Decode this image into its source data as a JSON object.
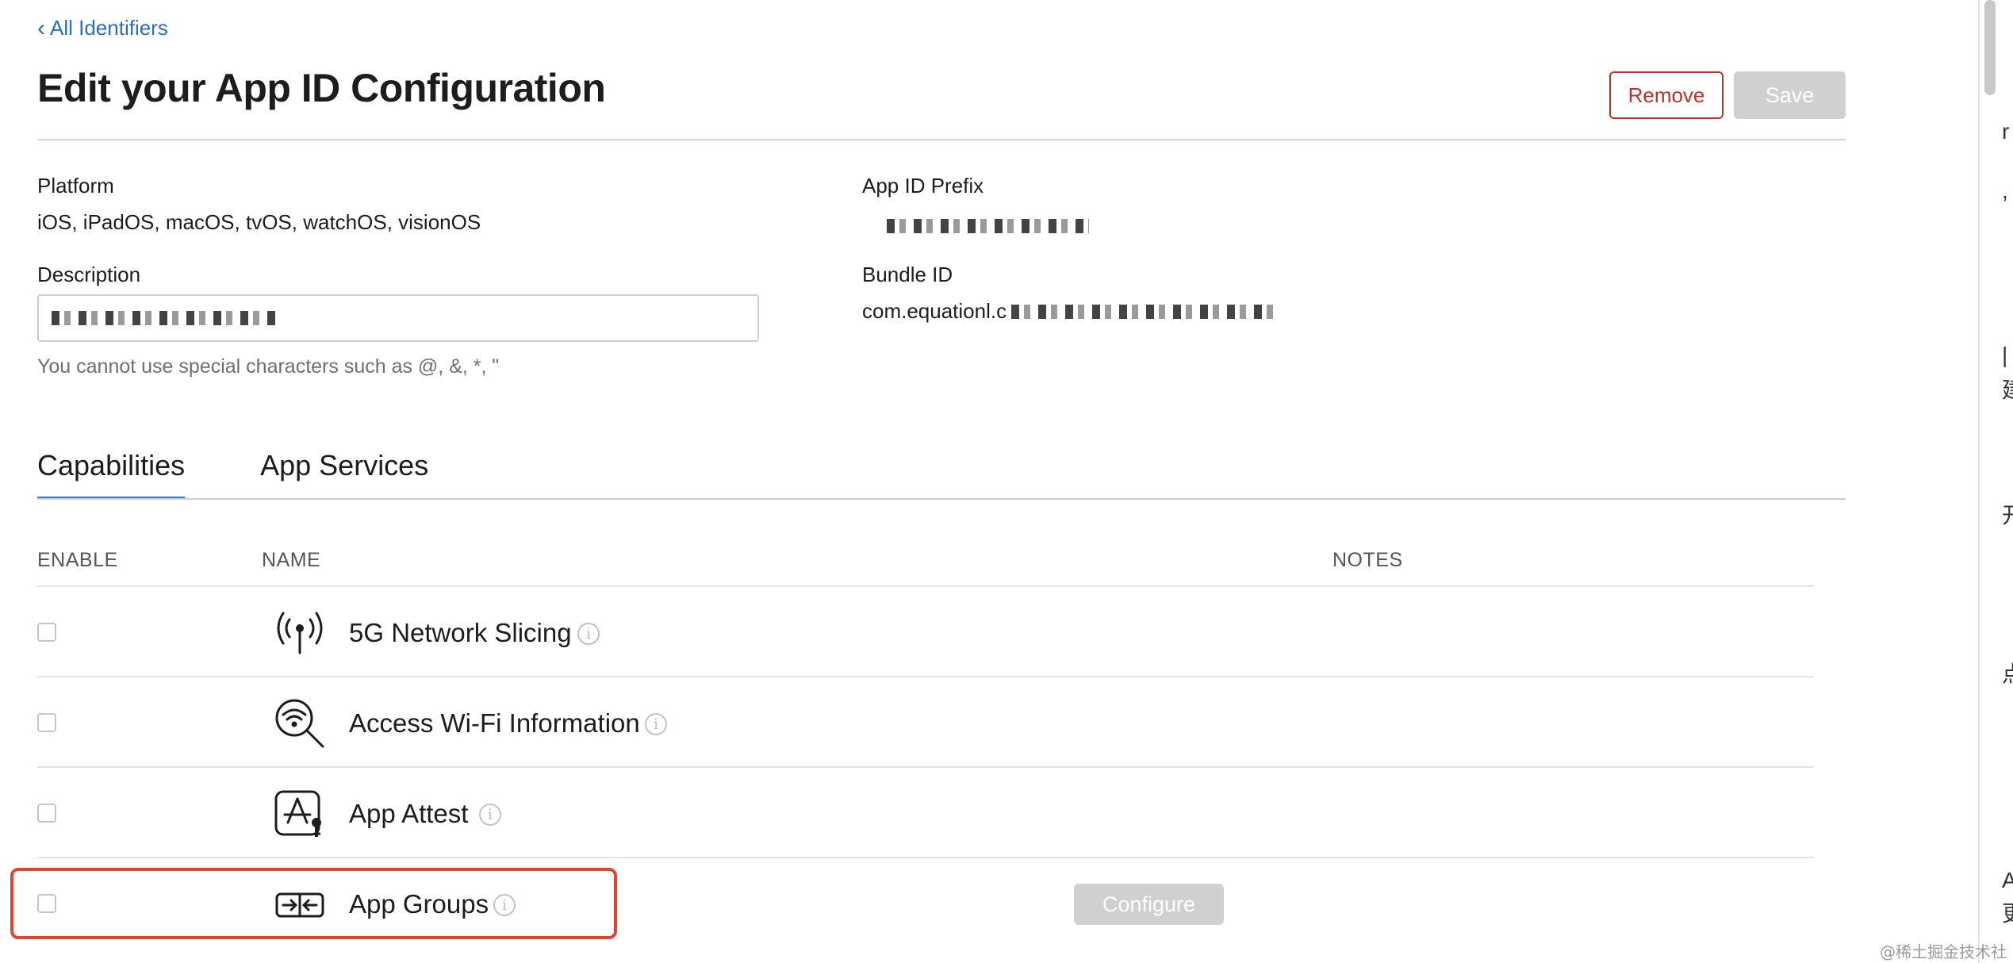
{
  "nav": {
    "back_label": "All Identifiers"
  },
  "page": {
    "title": "Edit your App ID Configuration"
  },
  "actions": {
    "remove_label": "Remove",
    "save_label": "Save"
  },
  "platform": {
    "label": "Platform",
    "value": "iOS, iPadOS, macOS, tvOS, watchOS, visionOS"
  },
  "app_id_prefix": {
    "label": "App ID Prefix"
  },
  "description": {
    "label": "Description",
    "hint": "You cannot use special characters such as @, &, *, \""
  },
  "bundle_id": {
    "label": "Bundle ID",
    "value_prefix": "com.equationl.c"
  },
  "tabs": [
    {
      "label": "Capabilities",
      "active": true
    },
    {
      "label": "App Services",
      "active": false
    }
  ],
  "table": {
    "headers": {
      "enable": "ENABLE",
      "name": "NAME",
      "notes": "NOTES"
    },
    "rows": [
      {
        "name": "5G Network Slicing",
        "icon": "antenna-icon",
        "enabled": false
      },
      {
        "name": "Access Wi-Fi Information",
        "icon": "wifi-search-icon",
        "enabled": false
      },
      {
        "name": "App Attest",
        "icon": "app-attest-icon",
        "enabled": false
      },
      {
        "name": "App Groups",
        "icon": "app-groups-icon",
        "enabled": false,
        "configure_label": "Configure"
      }
    ]
  },
  "watermark": "@稀土掘金技术社区",
  "side_glyphs": [
    "r",
    ",",
    "|",
    "建",
    "开",
    "点",
    "A",
    "更"
  ],
  "colors": {
    "accent": "#2b7ad6",
    "danger": "#b8322a",
    "disabled": "#d0d0d0",
    "highlight": "#d9482f"
  }
}
